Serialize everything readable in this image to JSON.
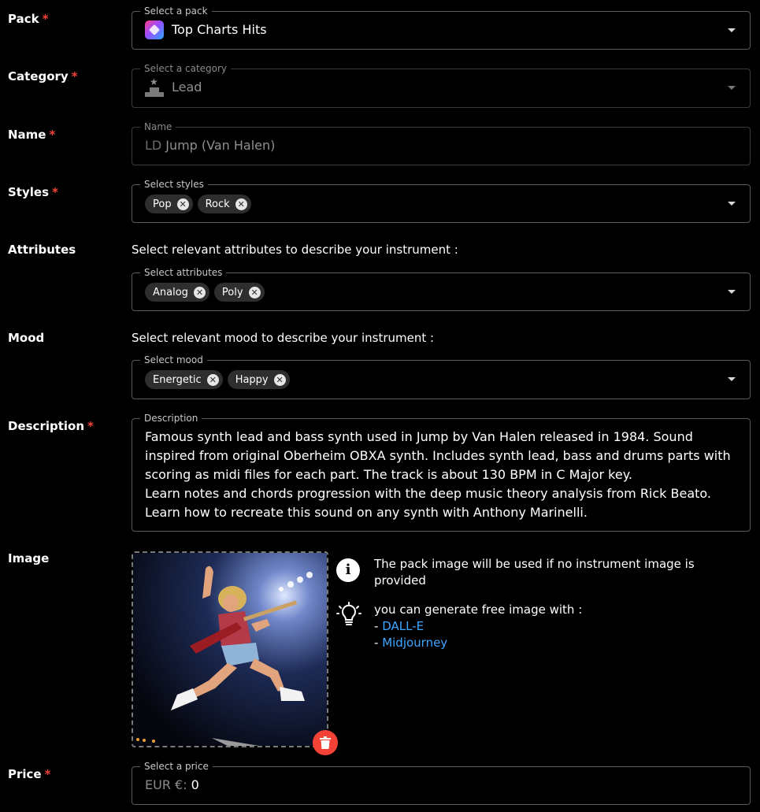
{
  "labels": {
    "pack": "Pack",
    "category": "Category",
    "name": "Name",
    "styles": "Styles",
    "attributes": "Attributes",
    "mood": "Mood",
    "description": "Description",
    "image": "Image",
    "price": "Price",
    "required_mark": "*"
  },
  "pack": {
    "legend": "Select a pack",
    "value": "Top Charts Hits"
  },
  "category": {
    "legend": "Select a category",
    "value": "Lead"
  },
  "name": {
    "legend": "Name",
    "prefix": "LD",
    "value": "Jump (Van Halen)"
  },
  "styles": {
    "legend": "Select styles",
    "chips": [
      "Pop",
      "Rock"
    ]
  },
  "attributes": {
    "helper": "Select relevant attributes to describe your instrument :",
    "legend": "Select attributes",
    "chips": [
      "Analog",
      "Poly"
    ]
  },
  "mood": {
    "helper": "Select relevant mood to describe your instrument :",
    "legend": "Select mood",
    "chips": [
      "Energetic",
      "Happy"
    ]
  },
  "description": {
    "legend": "Description",
    "value": "Famous synth lead and bass synth used in Jump by Van Halen released in 1984. Sound inspired from original Oberheim OBXA synth. Includes synth lead, bass and drums parts with scoring as midi files for each part. The track is about 130 BPM in C Major key.\nLearn notes and chords progression with the deep music theory analysis from Rick Beato.\nLearn how to recreate this sound on any synth with Anthony Marinelli."
  },
  "image": {
    "info": "The pack image will be used if no instrument image is provided",
    "tip": "you can generate free image with :",
    "dash": "- ",
    "link1": "DALL-E",
    "link2": "Midjourney"
  },
  "price": {
    "legend": "Select a price",
    "prefix": "EUR €:",
    "value": "0"
  },
  "colors": {
    "accent_red": "#f44336",
    "link_blue": "#3ea6ff",
    "chip_bg": "#2e2e2e"
  },
  "icons": [
    "pack-cover-icon",
    "podium-icon",
    "chip-remove-icon",
    "dropdown-caret-icon",
    "info-icon",
    "lightbulb-icon",
    "trash-icon"
  ]
}
